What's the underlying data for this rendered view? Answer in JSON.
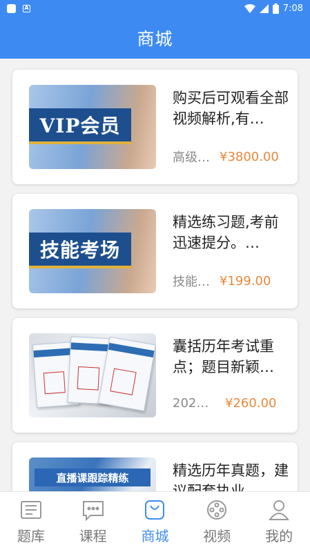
{
  "status_bar": {
    "time": "7:08"
  },
  "header": {
    "title": "商城"
  },
  "products": [
    {
      "image_text": "VIP会员",
      "description": "购买后可观看全部视频解析,有…",
      "name": "高级…",
      "price": "¥3800.00"
    },
    {
      "image_text": "技能考场",
      "description": "精选练习题,考前迅速提分。…",
      "name": "技能…",
      "price": "¥199.00"
    },
    {
      "image_text": "",
      "description": "囊括历年考试重点；题目新颖…",
      "name": "2021…",
      "price": "¥260.00"
    },
    {
      "image_text": "直播课跟踪精练",
      "description": "精选历年真题，建议配套执业…",
      "name": "",
      "price": ""
    }
  ],
  "tabs": [
    {
      "label": "题库",
      "icon": "question-bank-icon"
    },
    {
      "label": "课程",
      "icon": "course-chat-icon"
    },
    {
      "label": "商城",
      "icon": "shopping-bag-icon"
    },
    {
      "label": "视频",
      "icon": "video-reel-icon"
    },
    {
      "label": "我的",
      "icon": "profile-icon"
    }
  ],
  "active_tab": "商城",
  "colors": {
    "primary": "#3d8bf2",
    "price": "#e8883a",
    "background": "#f2f2f2"
  }
}
